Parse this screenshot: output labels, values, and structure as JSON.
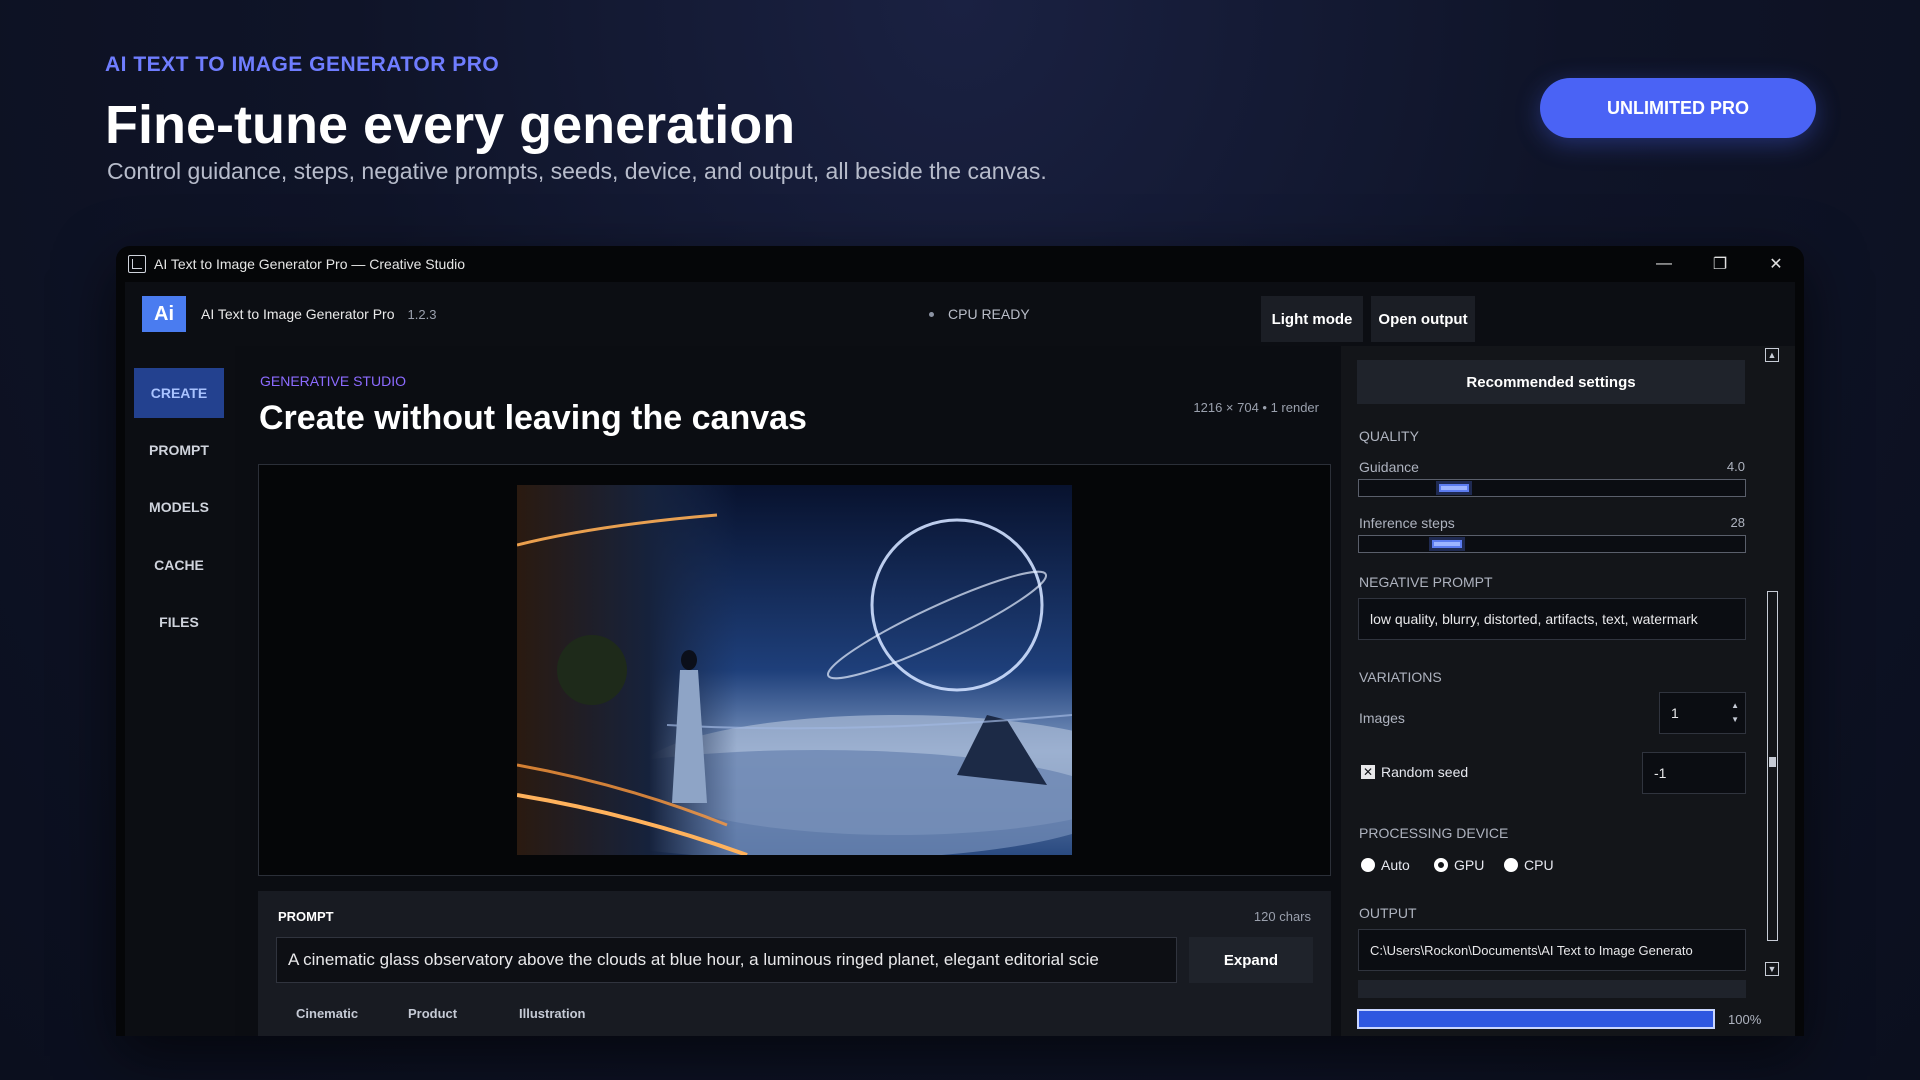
{
  "hero": {
    "eyebrow": "AI TEXT TO IMAGE GENERATOR PRO",
    "title": "Fine-tune every generation",
    "subtitle": "Control guidance, steps, negative prompts, seeds, device, and output, all beside the canvas.",
    "cta_label": "UNLIMITED PRO"
  },
  "window": {
    "title": "AI Text to Image Generator Pro — Creative Studio",
    "controls": {
      "minimize": "—",
      "restore": "❐",
      "close": "✕"
    }
  },
  "appbar": {
    "logo": "Ai",
    "app_name": "AI Text to Image Generator Pro",
    "version": "1.2.3",
    "status": "CPU READY",
    "light_mode_label": "Light mode",
    "open_output_label": "Open output"
  },
  "sidebar": {
    "items": [
      {
        "label": "CREATE",
        "active": true
      },
      {
        "label": "PROMPT",
        "active": false
      },
      {
        "label": "MODELS",
        "active": false
      },
      {
        "label": "CACHE",
        "active": false
      },
      {
        "label": "FILES",
        "active": false
      }
    ]
  },
  "main": {
    "eyebrow": "GENERATIVE STUDIO",
    "title": "Create without leaving the canvas",
    "meta": "1216 × 704  •  1 render"
  },
  "prompt": {
    "label": "PROMPT",
    "count": "120 chars",
    "value": "A cinematic glass observatory above the clouds at blue hour, a luminous ringed planet, elegant editorial scie",
    "expand_label": "Expand",
    "chips": [
      "Cinematic",
      "Product",
      "Illustration"
    ]
  },
  "settings": {
    "recommended_label": "Recommended settings",
    "quality_header": "QUALITY",
    "guidance": {
      "label": "Guidance",
      "value": "4.0",
      "level": 0.22
    },
    "steps": {
      "label": "Inference steps",
      "value": "28",
      "level": 0.2
    },
    "negative_header": "NEGATIVE PROMPT",
    "negative_value": "low quality, blurry, distorted, artifacts, text, watermark",
    "variations_header": "VARIATIONS",
    "images_label": "Images",
    "images_value": "1",
    "random_seed_label": "Random seed",
    "random_seed_checked": true,
    "seed_value": "-1",
    "device_header": "PROCESSING DEVICE",
    "devices": [
      {
        "label": "Auto",
        "selected": false
      },
      {
        "label": "GPU",
        "selected": true
      },
      {
        "label": "CPU",
        "selected": false
      }
    ],
    "output_header": "OUTPUT",
    "output_path": "C:\\Users\\Rockon\\Documents\\AI Text to Image Generato",
    "progress_label": "100%",
    "progress_level": 1.0
  },
  "colors": {
    "accent": "#4a63f5",
    "eyebrow": "#6f7dff",
    "studio_eyebrow": "#8c6bff",
    "sidebar_active": "#23418f"
  }
}
